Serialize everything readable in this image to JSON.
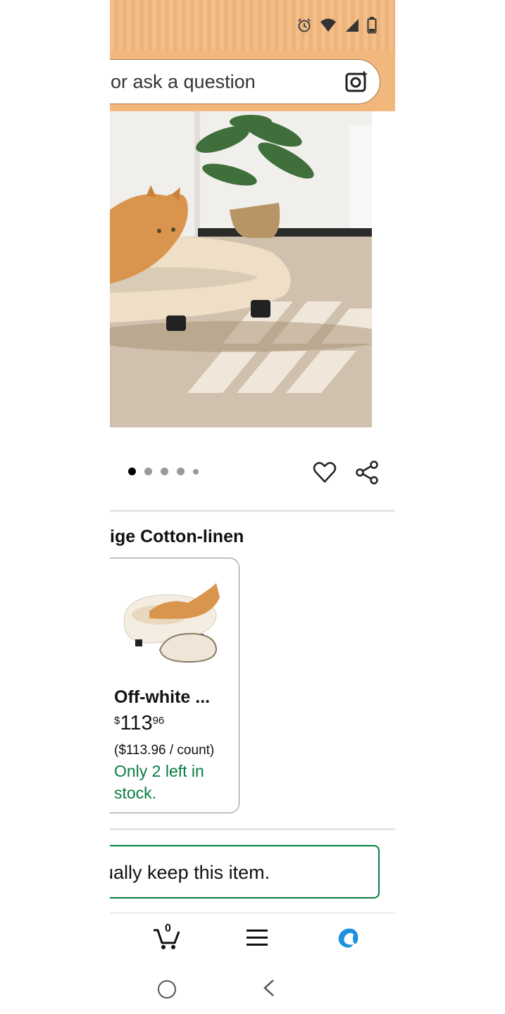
{
  "colors": {
    "header_bg": "#f2b77c",
    "stock_green": "#067d3f",
    "keep_border": "#067d3f"
  },
  "status_bar": {
    "icons": [
      "alarm-icon",
      "wifi-icon",
      "signal-icon",
      "battery-icon"
    ]
  },
  "search": {
    "text": "or ask a question",
    "camera_icon": "camera-sparkle-icon"
  },
  "gallery": {
    "dot_count": 5,
    "active_index": 0,
    "heart_icon": "heart-icon",
    "share_icon": "share-icon"
  },
  "variant": {
    "title": "ige Cotton-linen",
    "card": {
      "title": "Off-white ...",
      "price_symbol": "$",
      "price_whole": "113",
      "price_fraction": "96",
      "unit_price": "($113.96 / count)",
      "stock": "Only 2 left in stock."
    }
  },
  "keep_notice": {
    "text": "ually keep this item."
  },
  "bottom_nav": {
    "cart_count": "0",
    "icons": [
      "cart-icon",
      "menu-icon",
      "alexa-icon"
    ]
  },
  "system_nav": {
    "icons": [
      "home-icon",
      "back-icon"
    ]
  }
}
